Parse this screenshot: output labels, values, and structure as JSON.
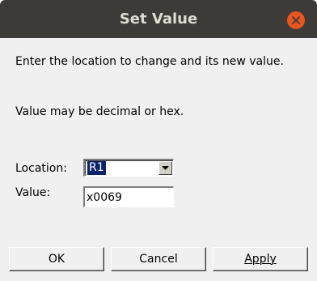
{
  "window": {
    "title": "Set Value"
  },
  "instructions": {
    "line1": "Enter the location to change and its new value.",
    "line2": "Value may be decimal or hex."
  },
  "form": {
    "location_label": "Location:",
    "location_value": "R1",
    "value_label": "Value:",
    "value_value": "x0069"
  },
  "buttons": {
    "ok_label": "OK",
    "cancel_label": "Cancel",
    "apply_label": "Apply"
  },
  "icons": {
    "close": "close-icon",
    "dropdown": "chevron-down-icon"
  },
  "colors": {
    "titlebar": "#3c3b37",
    "close_button": "#e9541f",
    "dialog_background": "#f0f0f0",
    "selection_highlight": "#0a246a"
  }
}
